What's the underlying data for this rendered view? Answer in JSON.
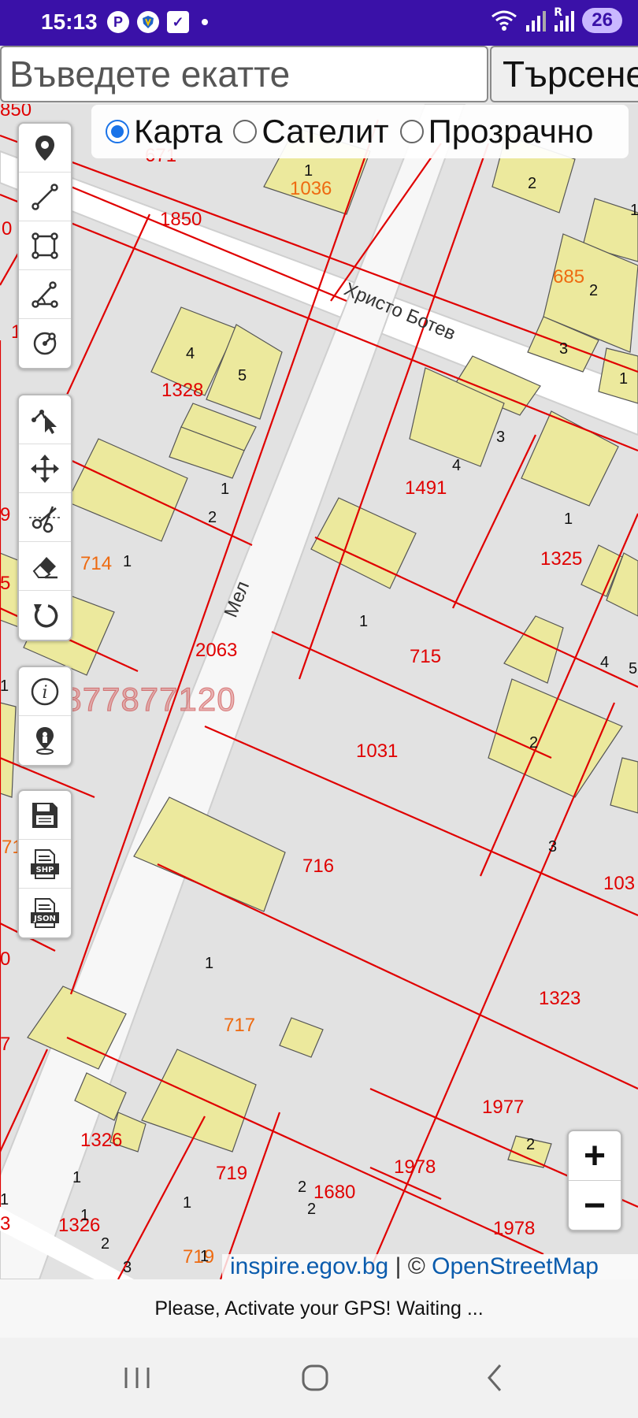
{
  "status_bar": {
    "time": "15:13",
    "icons_left": [
      "pinterest-icon",
      "shield-app-icon",
      "checkbox-app-icon",
      "dot-icon"
    ],
    "icons_right": [
      "wifi-icon",
      "signal-icon",
      "signal-roaming-icon"
    ],
    "battery": "26",
    "roaming_label": "R"
  },
  "search": {
    "placeholder": "Въведете екатте",
    "value": "",
    "button_label": "Търсене"
  },
  "layers": {
    "options": [
      {
        "label": "Карта",
        "checked": true
      },
      {
        "label": "Сателит",
        "checked": false
      },
      {
        "label": "Прозрачно",
        "checked": false
      }
    ]
  },
  "toolbars": {
    "draw": [
      "point-marker-icon",
      "line-icon",
      "polygon-icon",
      "angle-measure-icon",
      "circle-icon"
    ],
    "edit": [
      "select-pointer-icon",
      "move-arrows-icon",
      "scissors-icon",
      "eraser-icon",
      "undo-icon"
    ],
    "info": [
      "info-icon",
      "location-pin-icon"
    ],
    "export": [
      "save-disk-icon",
      "shp-file-icon",
      "json-file-icon"
    ],
    "shp_label": "SHP",
    "json_label": "JSON"
  },
  "map": {
    "street_labels": [
      "Христо Ботев",
      "Мел"
    ],
    "parcel_labels": [
      "850",
      "671",
      "1036",
      "1850",
      "685",
      "1328",
      "1491",
      "1325",
      "714",
      "2063",
      "715",
      "1031",
      "716",
      "1323",
      "717",
      "1977",
      "1326",
      "719",
      "1978",
      "1680",
      "1326",
      "719",
      "1978",
      "103",
      "0",
      "9",
      "5",
      "1",
      "71",
      "0",
      "7",
      "3"
    ],
    "building_labels": [
      "1",
      "2",
      "1",
      "2",
      "3",
      "1",
      "4",
      "5",
      "1",
      "2",
      "1",
      "3",
      "4",
      "1",
      "1",
      "1",
      "4",
      "5",
      "2",
      "3",
      "1",
      "1",
      "1",
      "2",
      "2",
      "1",
      "2",
      "3",
      "1",
      "1",
      "2"
    ],
    "watermark": "0877877120"
  },
  "zoom": {
    "in_label": "+",
    "out_label": "−"
  },
  "attribution": {
    "link1": "inspire.egov.bg",
    "separator": " | © ",
    "link2": "OpenStreetMap"
  },
  "gps_message": "Please, Activate your GPS! Waiting ...",
  "nav": [
    "recent-apps-icon",
    "home-icon",
    "back-icon"
  ]
}
